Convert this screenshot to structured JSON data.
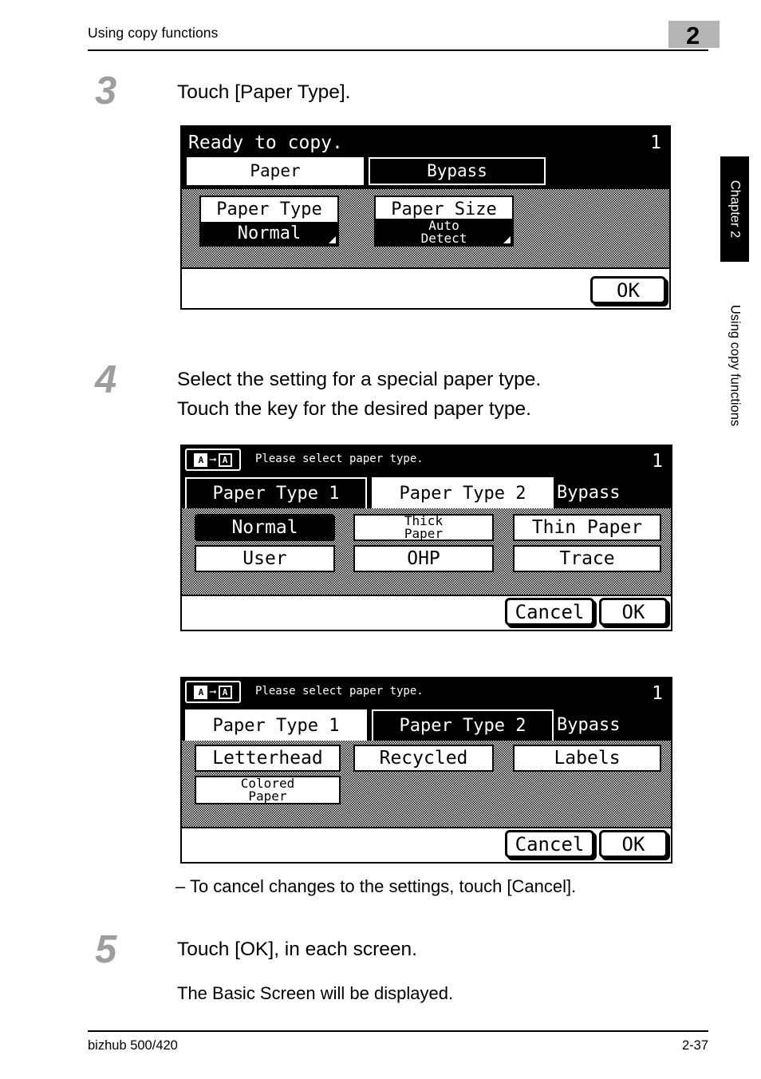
{
  "header": {
    "title": "Using copy functions",
    "chapter_number": "2"
  },
  "footer": {
    "product": "bizhub 500/420",
    "page_number": "2-37"
  },
  "sidetabs": {
    "chapter": "Chapter 2",
    "section": "Using copy functions"
  },
  "steps": [
    {
      "number": "3",
      "text": "Touch [Paper Type]."
    },
    {
      "number": "4",
      "text": "Select the setting for a special paper type.\nTouch the key for the desired paper type."
    },
    {
      "number": "5",
      "text": "Touch [OK], in each screen."
    }
  ],
  "notes": {
    "cancel_note": "– To cancel changes to the settings, touch [Cancel].",
    "step5_result": "The Basic Screen will be displayed."
  },
  "screen1": {
    "status": "Ready to copy.",
    "count": "1",
    "tabs": [
      {
        "label": "Paper",
        "state": "selected"
      },
      {
        "label": "Bypass",
        "state": "normal"
      }
    ],
    "keys": [
      {
        "title": "Paper Type",
        "value": "Normal"
      },
      {
        "title": "Paper Size",
        "value": "Auto\nDetect"
      }
    ],
    "buttons": [
      {
        "label": "OK"
      }
    ]
  },
  "screen2": {
    "icon": "original-to-copy-icon",
    "status": "Please select paper type.",
    "count": "1",
    "tabs": [
      {
        "label": "Paper Type 1",
        "state": "normal"
      },
      {
        "label": "Paper Type 2",
        "state": "selected"
      },
      {
        "label": "Bypass",
        "state": "plain"
      }
    ],
    "keys": [
      {
        "label": "Normal",
        "state": "selected"
      },
      {
        "label": "Thick\nPaper",
        "state": "normal"
      },
      {
        "label": "Thin Paper",
        "state": "normal"
      },
      {
        "label": "User",
        "state": "normal"
      },
      {
        "label": "OHP",
        "state": "normal"
      },
      {
        "label": "Trace",
        "state": "normal"
      }
    ],
    "buttons": [
      {
        "label": "Cancel"
      },
      {
        "label": "OK"
      }
    ]
  },
  "screen3": {
    "icon": "original-to-copy-icon",
    "status": "Please select paper type.",
    "count": "1",
    "tabs": [
      {
        "label": "Paper Type 1",
        "state": "selected"
      },
      {
        "label": "Paper Type 2",
        "state": "normal"
      },
      {
        "label": "Bypass",
        "state": "plain"
      }
    ],
    "keys": [
      {
        "label": "Letterhead",
        "state": "normal"
      },
      {
        "label": "Recycled",
        "state": "normal"
      },
      {
        "label": "Labels",
        "state": "normal"
      },
      {
        "label": "Colored\nPaper",
        "state": "normal"
      }
    ],
    "buttons": [
      {
        "label": "Cancel"
      },
      {
        "label": "OK"
      }
    ]
  }
}
